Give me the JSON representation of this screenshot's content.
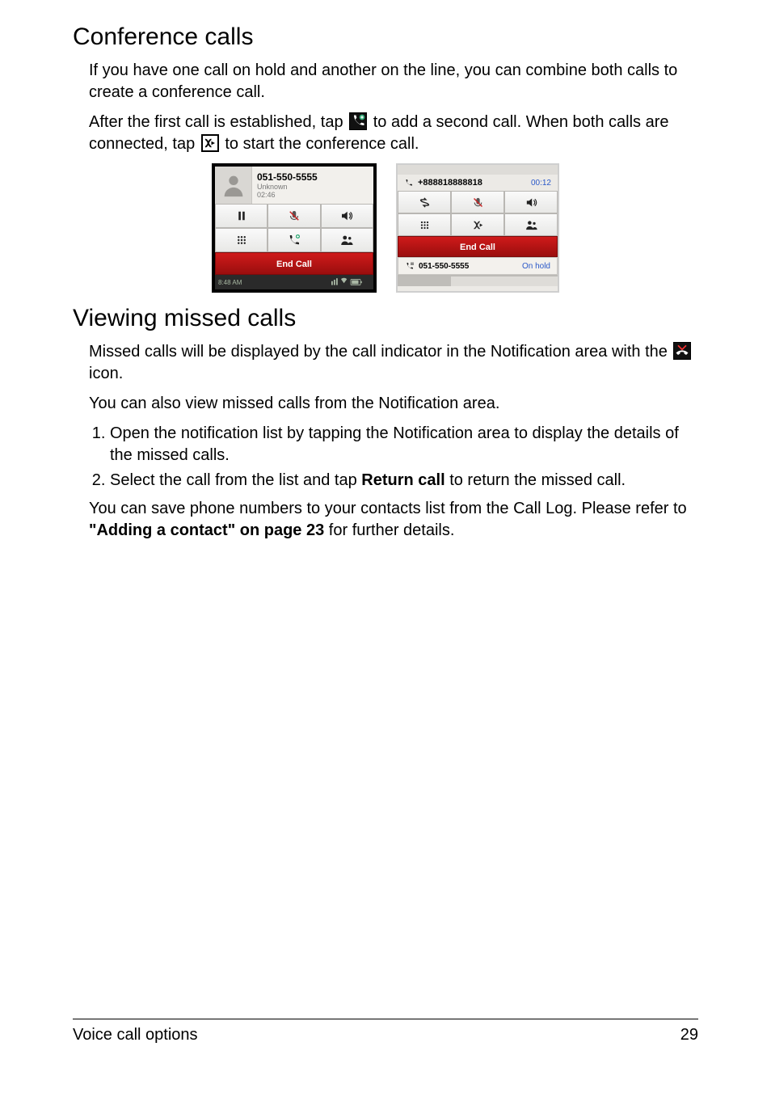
{
  "headings": {
    "conference": "Conference calls",
    "missed": "Viewing missed calls"
  },
  "conference": {
    "intro": "If you have one call on hold and another on the line, you can combine both calls to create a conference call.",
    "after_pre": "After the first call is established, tap ",
    "after_post": " to add a second call. When both calls are connected, tap ",
    "after_tail": " to start the conference call."
  },
  "shot1": {
    "number": "051-550-5555",
    "name": "Unknown",
    "duration": "02:46",
    "end_call": "End Call",
    "status_time": "8:48 AM",
    "icons": {
      "pause": "pause-icon",
      "mute": "mute-mic-icon",
      "speaker": "speaker-icon",
      "dialpad": "dialpad-icon",
      "add_call": "add-call-icon",
      "contacts": "contacts-icon"
    }
  },
  "shot2": {
    "active_number": "+888818888818",
    "active_time": "00:12",
    "end_call": "End Call",
    "held_number": "051-550-5555",
    "held_status": "On hold",
    "icons": {
      "swap": "swap-calls-icon",
      "mute": "mute-mic-icon",
      "speaker": "speaker-icon",
      "dialpad": "dialpad-icon",
      "merge": "merge-calls-icon",
      "contacts": "contacts-icon"
    }
  },
  "missed": {
    "intro_pre": "Missed calls will be displayed by the call indicator in the Notification area with the ",
    "intro_post": " icon.",
    "also": "You can also view missed calls from the Notification area.",
    "steps": [
      "Open the notification list by tapping the Notification area to display the details of the missed calls.",
      "Select the call from the list and tap Return call to return the missed call."
    ],
    "step2_pre": "Select the call from the list and tap ",
    "step2_bold": "Return call",
    "step2_post": " to return the missed call.",
    "save_pre": "You can save phone numbers to your contacts list from the Call Log. Please refer to ",
    "save_bold": "\"Adding a contact\" on page 23",
    "save_post": " for further details."
  },
  "footer": {
    "section": "Voice call options",
    "page": "29"
  }
}
